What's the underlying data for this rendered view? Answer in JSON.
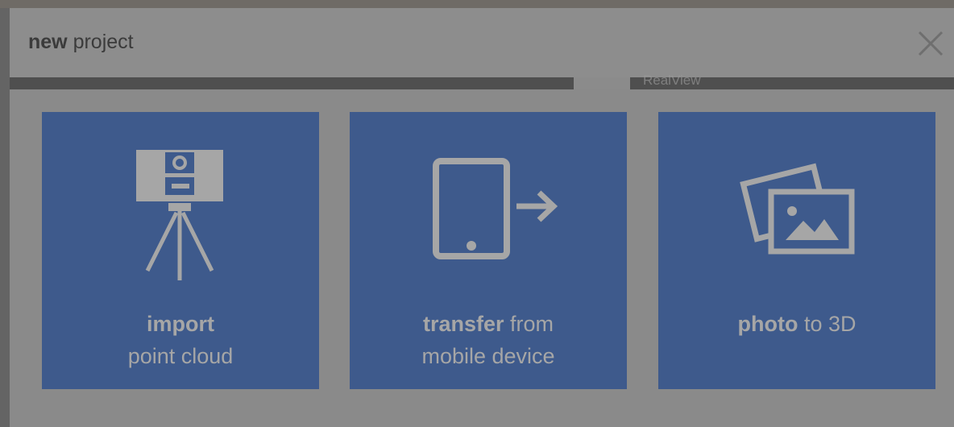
{
  "dialog": {
    "title_bold": "new",
    "title_rest": "project",
    "close_icon": "close-icon"
  },
  "background": {
    "partial_text": "RealView"
  },
  "tiles": [
    {
      "icon": "scanner-tripod-icon",
      "line1_bold": "import",
      "line1_rest": "",
      "line2": "point cloud"
    },
    {
      "icon": "tablet-transfer-icon",
      "line1_bold": "transfer",
      "line1_rest": " from",
      "line2": "mobile device"
    },
    {
      "icon": "photos-icon",
      "line1_bold": "photo",
      "line1_rest": " to 3D",
      "line2": ""
    }
  ],
  "colors": {
    "tile": "#3e5a8c",
    "overlay_dim": "#646464",
    "header": "#8d8d8d"
  }
}
